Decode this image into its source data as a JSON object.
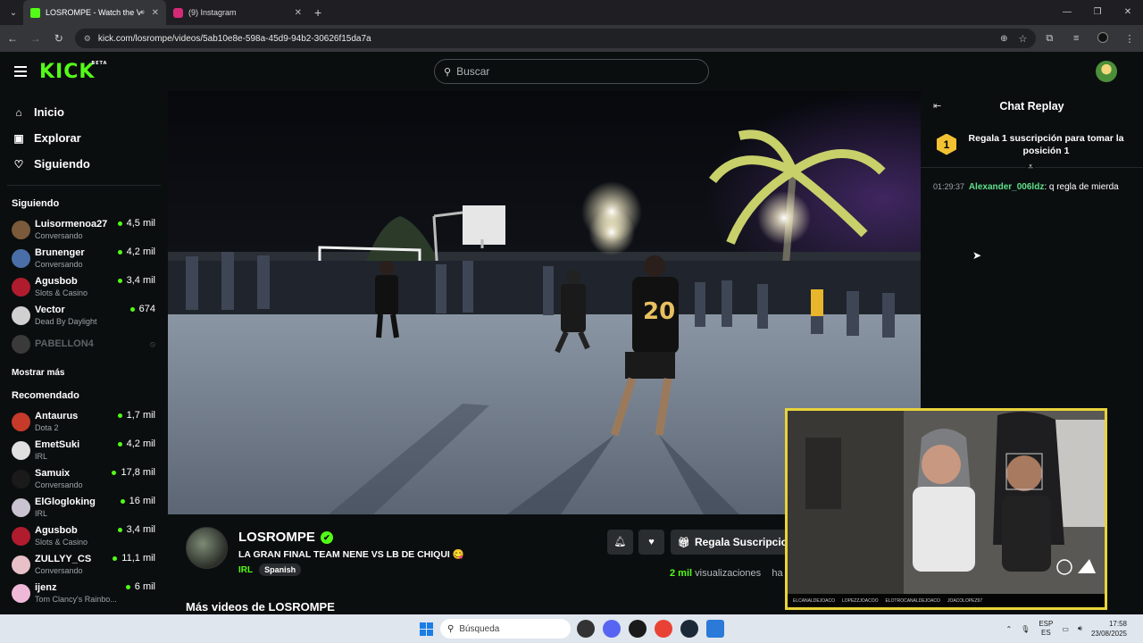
{
  "browser": {
    "tabs": [
      {
        "title": "LOSROMPE - Watch the VO",
        "active": true,
        "favicon_color": "#53fc18"
      },
      {
        "title": "(9) Instagram",
        "active": false,
        "favicon_color": "#d62976"
      }
    ],
    "url": "kick.com/losrompe/videos/5ab10e8e-598a-45d9-94b2-30626f15da7a"
  },
  "header": {
    "logo": "KICK",
    "logo_badge": "BETA",
    "search_placeholder": "Buscar"
  },
  "sidebar": {
    "nav": [
      {
        "label": "Inicio",
        "icon": "home-icon"
      },
      {
        "label": "Explorar",
        "icon": "explore-icon"
      },
      {
        "label": "Siguiendo",
        "icon": "heart-icon"
      }
    ],
    "following_title": "Siguiendo",
    "following": [
      {
        "name": "Luisormenoa27",
        "category": "Conversando",
        "viewers": "4,5 mil",
        "color": "#7a5a3a"
      },
      {
        "name": "Brunenger",
        "category": "Conversando",
        "viewers": "4,2 mil",
        "color": "#4a6fa8"
      },
      {
        "name": "Agusbob",
        "category": "Slots & Casino",
        "viewers": "3,4 mil",
        "color": "#b01c2e"
      },
      {
        "name": "Vector",
        "category": "Dead By Daylight",
        "viewers": "674",
        "color": "#d0d0d0"
      }
    ],
    "offline_channel": {
      "name": "PABELLON4",
      "color": "#3a3a3a"
    },
    "show_more": "Mostrar más",
    "recommended_title": "Recomendado",
    "recommended": [
      {
        "name": "Antaurus",
        "category": "Dota 2",
        "viewers": "1,7 mil",
        "color": "#c63a2a"
      },
      {
        "name": "EmetSuki",
        "category": "IRL",
        "viewers": "4,2 mil",
        "color": "#e0e0e0"
      },
      {
        "name": "Samuix",
        "category": "Conversando",
        "viewers": "17,8 mil",
        "color": "#1a1a1a"
      },
      {
        "name": "ElGlogloking",
        "category": "IRL",
        "viewers": "16 mil",
        "color": "#c9c2d0"
      },
      {
        "name": "Agusbob",
        "category": "Slots & Casino",
        "viewers": "3,4 mil",
        "color": "#b01c2e"
      },
      {
        "name": "ZULLYY_CS",
        "category": "Conversando",
        "viewers": "11,1 mil",
        "color": "#e7c0c8"
      },
      {
        "name": "ijenz",
        "category": "Tom Clancy's Rainbo...",
        "viewers": "6 mil",
        "color": "#f0b8d8"
      }
    ]
  },
  "video_info": {
    "channel": "LOSROMPE",
    "title": "LA GRAN FINAL TEAM NENE VS LB DE CHIQUI",
    "category": "IRL",
    "tag": "Spanish",
    "gift_button": "Regala Suscripcion",
    "views_count": "2 mil",
    "views_label": "visualizaciones",
    "views_suffix": "ha",
    "more_videos": "Más videos de LOSROMPE"
  },
  "chat": {
    "title": "Chat Replay",
    "gift_rank": "1",
    "gift_text": "Regala 1 suscripción para tomar la posición 1",
    "messages": [
      {
        "time": "01:29:37",
        "user": "Alexander_006ldz",
        "text": ": q regla de mierda"
      }
    ]
  },
  "webcam_ticker": [
    "ELCANALDEJOACO",
    "LOPEZZJOACOO",
    "ELOTROCANALDEJOACO",
    "JOACOLOPEZ97"
  ],
  "taskbar": {
    "search_placeholder": "Búsqueda",
    "lang_top": "ESP",
    "lang_bottom": "ES",
    "time": "17:58",
    "date": "23/08/2025"
  }
}
